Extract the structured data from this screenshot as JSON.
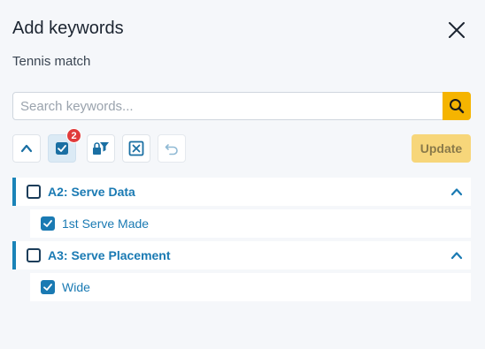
{
  "dialog": {
    "title": "Add keywords",
    "subtitle": "Tennis match"
  },
  "search": {
    "placeholder": "Search keywords..."
  },
  "toolbar": {
    "badge_count": "2",
    "update_label": "Update"
  },
  "groups": [
    {
      "label": "A2: Serve Data",
      "items": [
        {
          "label": "1st Serve Made",
          "checked": true
        }
      ]
    },
    {
      "label": "A3: Serve Placement",
      "items": [
        {
          "label": "Wide",
          "checked": true
        }
      ]
    }
  ],
  "colors": {
    "accent": "#1a7ab3",
    "search_button": "#f5b400",
    "update_button": "#f7d67a",
    "badge": "#e03b3b"
  }
}
